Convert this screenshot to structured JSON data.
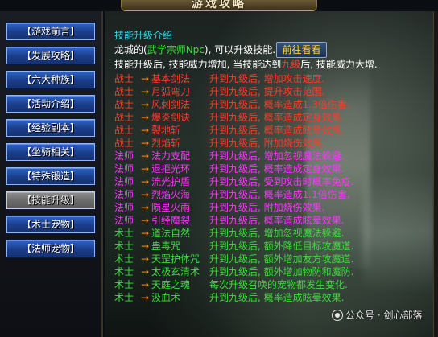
{
  "window": {
    "title": "游戏攻略"
  },
  "nav": [
    {
      "label": "【游戏前言】",
      "disabled": false
    },
    {
      "label": "【发展攻略】",
      "disabled": false
    },
    {
      "label": "【六大种族】",
      "disabled": false
    },
    {
      "label": "【活动介绍】",
      "disabled": false
    },
    {
      "label": "【经验副本】",
      "disabled": false
    },
    {
      "label": "【坐骑相关】",
      "disabled": false
    },
    {
      "label": "【特殊锻造】",
      "disabled": false
    },
    {
      "label": "【技能升级】",
      "disabled": true
    },
    {
      "label": "【术士宠物】",
      "disabled": false
    },
    {
      "label": "【法师宠物】",
      "disabled": false
    }
  ],
  "intro": {
    "title": "技能升级介绍",
    "line1_prefix": "龙城的(",
    "npc": "武学宗师Npc",
    "line1_suffix": "), 可以升级技能.",
    "goto_button": "前往看看",
    "line2_prefix": "技能升级后, 技能威力增加, 当技能达到",
    "line2_highlight": "九级",
    "line2_suffix": "后, 技能威力大增."
  },
  "arrow": "→",
  "skills": [
    {
      "cls": "战士",
      "skill": "基本剑法",
      "desc": "升到九级后, 增加攻击速度.",
      "color": "#ff3a2a"
    },
    {
      "cls": "战士",
      "skill": "月弧弯刀",
      "desc": "升到九级后, 提升攻击范围.",
      "color": "#ff3a2a"
    },
    {
      "cls": "战士",
      "skill": "风刺剑法",
      "desc": "升到九级后, 概率造成1.3倍伤害.",
      "color": "#ff3a2a"
    },
    {
      "cls": "战士",
      "skill": "爆炎剑诀",
      "desc": "升到九级后, 概率造成定身效果.",
      "color": "#ff3a2a"
    },
    {
      "cls": "战士",
      "skill": "裂地斩",
      "desc": "升到九级后, 概率造成眩晕效果.",
      "color": "#ff3a2a"
    },
    {
      "cls": "战士",
      "skill": "烈焰斩",
      "desc": "升到九级后, 附加烧伤效果.",
      "color": "#ff3a2a"
    },
    {
      "cls": "法师",
      "skill": "法力支配",
      "desc": "升到九级后, 增加忽视魔法躲避.",
      "color": "#ff33ff"
    },
    {
      "cls": "法师",
      "skill": "退拒光环",
      "desc": "升到九级后, 概率造成定身效果.",
      "color": "#ff33ff"
    },
    {
      "cls": "法师",
      "skill": "流光护盾",
      "desc": "升到九级后, 受到攻击时概率免疫.",
      "color": "#ff33ff"
    },
    {
      "cls": "法师",
      "skill": "烈焰火海",
      "desc": "升到九级后, 概率造成1.1倍伤害.",
      "color": "#ff33ff"
    },
    {
      "cls": "法师",
      "skill": "陨星火雨",
      "desc": "升到九级后, 附加烧伤效果.",
      "color": "#ff33ff"
    },
    {
      "cls": "法师",
      "skill": "引经魔裂",
      "desc": "升到九级后, 概率造成眩晕效果.",
      "color": "#ff33ff"
    },
    {
      "cls": "术士",
      "skill": "道法自然",
      "desc": "升到九级后, 增加忽视魔法躲避.",
      "color": "#3ddc3d"
    },
    {
      "cls": "术士",
      "skill": "蛊毒咒",
      "desc": "升到九级后, 额外降低目标攻魔道.",
      "color": "#3ddc3d"
    },
    {
      "cls": "术士",
      "skill": "天罡护体咒",
      "desc": "升到九级后, 额外增加友方攻魔道.",
      "color": "#3ddc3d"
    },
    {
      "cls": "术士",
      "skill": "太极玄清术",
      "desc": "升到九级后, 额外增加物防和魔防.",
      "color": "#3ddc3d"
    },
    {
      "cls": "术士",
      "skill": "天庭之魂",
      "desc": "每次升级召唤的宠物都发生变化.",
      "color": "#3ddc3d"
    },
    {
      "cls": "术士",
      "skill": "汲血术",
      "desc": "升到九级后, 概率造成眩晕效果.",
      "color": "#3ddc3d"
    }
  ],
  "watermark": {
    "text": "公众号 · 剑心部落"
  }
}
